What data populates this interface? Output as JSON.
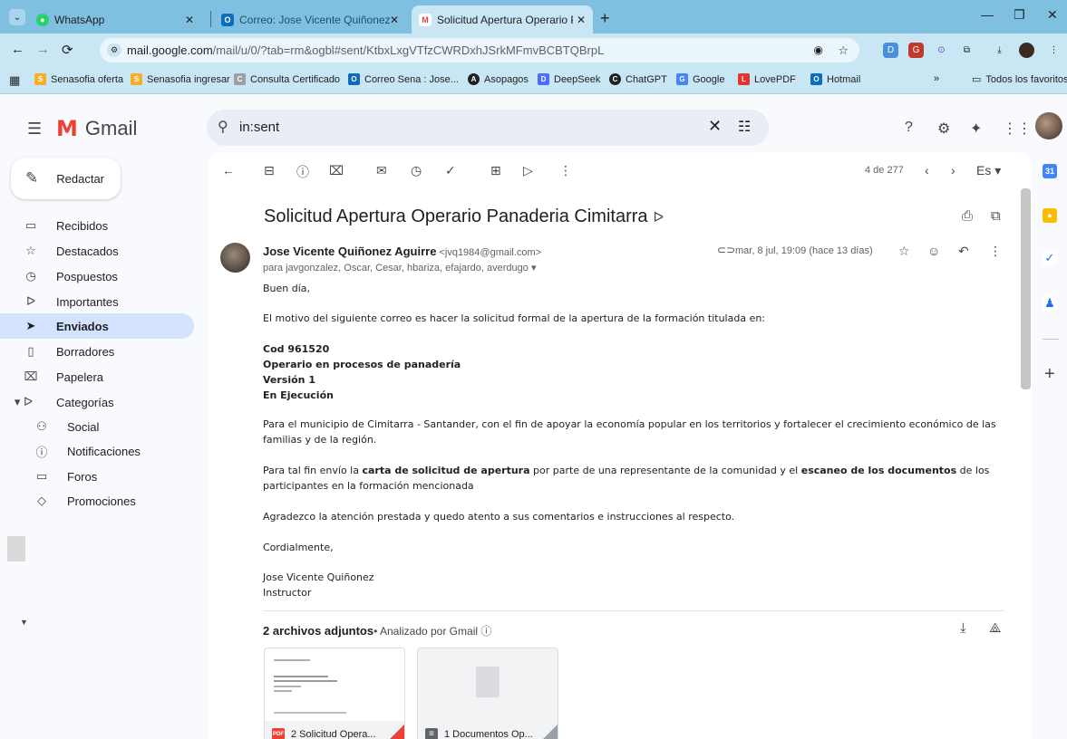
{
  "browser": {
    "tabs": [
      {
        "title": "WhatsApp",
        "icon": "whatsapp-icon",
        "color": "#25d366"
      },
      {
        "title": "Correo: Jose Vicente Quiñonez",
        "icon": "outlook-icon",
        "color": "#0f6cbd"
      },
      {
        "title": "Solicitud Apertura Operario Par",
        "icon": "gmail-icon",
        "color": "#ea4335"
      }
    ],
    "url_host": "mail.google.com",
    "url_rest": "/mail/u/0/?tab=rm&ogbl#sent/KtbxLxgVTfzCWRDxhJSrkMFmvBCBTQBrpL",
    "bookmarks": [
      {
        "label": "Senasofia oferta",
        "icon": "S",
        "color": "#f6b026"
      },
      {
        "label": "Senasofia ingresar",
        "icon": "S",
        "color": "#f6b026"
      },
      {
        "label": "Consulta Certificado",
        "icon": "C",
        "color": "#9aa0a6"
      },
      {
        "label": "Correo Sena : Jose...",
        "icon": "O",
        "color": "#0f6cbd"
      },
      {
        "label": "Asopagos",
        "icon": "A",
        "color": "#202124"
      },
      {
        "label": "DeepSeek",
        "icon": "D",
        "color": "#4d6bfe"
      },
      {
        "label": "ChatGPT",
        "icon": "C",
        "color": "#202124"
      },
      {
        "label": "Google",
        "icon": "G",
        "color": "#4285f4"
      },
      {
        "label": "LovePDF",
        "icon": "L",
        "color": "#e5322d"
      },
      {
        "label": "Hotmail",
        "icon": "O",
        "color": "#0f6cbd"
      }
    ],
    "more_label": "»",
    "all_bookmarks": "Todos los favoritos"
  },
  "gmail": {
    "logo_text": "Gmail",
    "search_value": "in:sent",
    "compose_label": "Redactar",
    "nav": [
      {
        "label": "Recibidos",
        "icon": "▭"
      },
      {
        "label": "Destacados",
        "icon": "☆"
      },
      {
        "label": "Pospuestos",
        "icon": "◷"
      },
      {
        "label": "Importantes",
        "icon": "ᐅ"
      },
      {
        "label": "Enviados",
        "icon": "➤"
      },
      {
        "label": "Borradores",
        "icon": "▯"
      },
      {
        "label": "Papelera",
        "icon": "🗑"
      },
      {
        "label": "Categorías",
        "icon": "▾ᐅ"
      }
    ],
    "categories": [
      {
        "label": "Social",
        "icon": "👥"
      },
      {
        "label": "Notificaciones",
        "icon": "ⓘ"
      },
      {
        "label": "Foros",
        "icon": "▭"
      },
      {
        "label": "Promociones",
        "icon": "◇"
      }
    ],
    "pager": "4 de 277",
    "lang": "Es ▾"
  },
  "email": {
    "subject": "Solicitud Apertura Operario Panaderia Cimitarra",
    "sender_name": "Jose Vicente Quiñonez Aguirre",
    "sender_email": "<jvq1984@gmail.com>",
    "recipients": "para javgonzalez, Oscar, Cesar, hbariza, efajardo, averdugo ▾",
    "date": "mar, 8 jul, 19:09 (hace 13 días)",
    "greeting": "Buen día,",
    "intro": "El motivo del siguiente correo es hacer la solicitud formal de la apertura de la formación titulada en:",
    "course_code": "Cod 961520",
    "course_name": "Operario en procesos de panadería",
    "course_version": "Versión 1",
    "course_status": "En Ejecución",
    "para1": "Para el municipio de Cimitarra - Santander, con el fin de apoyar la economía popular en los territorios y fortalecer el crecimiento económico de las familias y de la región.",
    "para2_a": "Para tal fin envío la ",
    "para2_b": "carta de solicitud de apertura",
    "para2_c": " por parte de una representante de la comunidad y el ",
    "para2_d": "escaneo de los documentos",
    "para2_e": " de los participantes en la formación mencionada",
    "para3": "Agradezco la atención prestada y quedo atento a sus comentarios e instrucciones al respecto.",
    "closing": "Cordialmente,",
    "sig_name": "Jose Vicente Quiñonez",
    "sig_title": "Instructor",
    "attach_count": "2 archivos adjuntos",
    "attach_scan": "• Analizado por Gmail ⓘ",
    "attachments": [
      {
        "name": "2 Solicitud Opera...",
        "type": "PDF",
        "color": "#ea4335"
      },
      {
        "name": "1 Documentos Op...",
        "type": "≡",
        "color": "#5f6368"
      }
    ]
  }
}
